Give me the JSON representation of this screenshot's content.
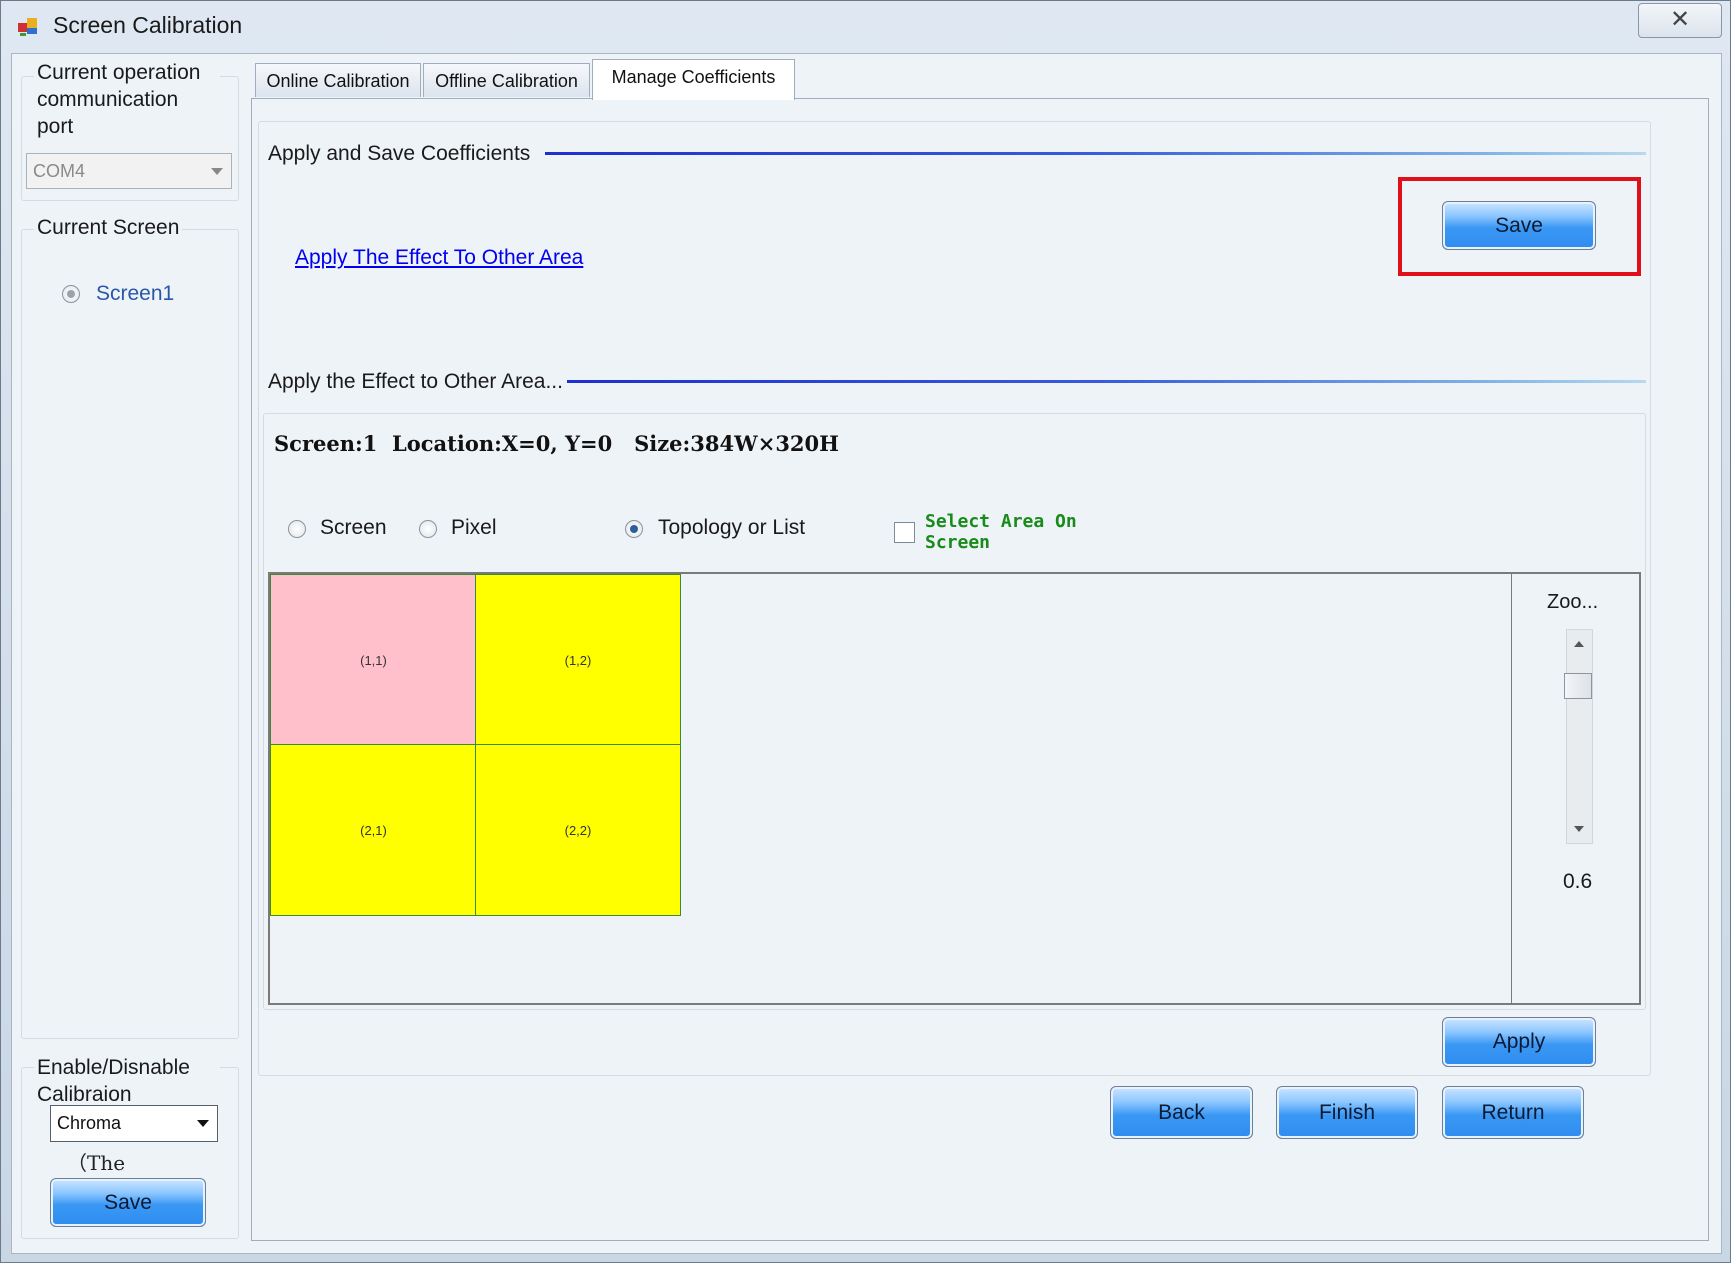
{
  "window": {
    "title": "Screen Calibration",
    "close_glyph": "✕"
  },
  "left": {
    "comm_group_label": "Current operation communication port",
    "com_port": "COM4",
    "screen_group_label": "Current Screen",
    "screen_item": "Screen1",
    "enable_group_label": "Enable/Disnable Calibraion",
    "enable_option": "Chroma",
    "note_text": "（The",
    "save_label": "Save"
  },
  "tabs": [
    {
      "label": "Online Calibration",
      "active": false
    },
    {
      "label": "Offline Calibration",
      "active": false
    },
    {
      "label": "Manage Coefficients",
      "active": true
    }
  ],
  "apply_save": {
    "title": "Apply and Save Coefficients",
    "link_text": "Apply The Effect To Other Area",
    "save_label": "Save"
  },
  "apply_other": {
    "title": "Apply the Effect to Other Area...",
    "info_text": "Screen:1  Location:X=0, Y=0   Size:384W×320H",
    "options": [
      "Screen",
      "Pixel",
      "Topology or List"
    ],
    "selected_option": "Topology or List",
    "select_area_label_line1": "Select Area On",
    "select_area_label_line2": "Screen",
    "cells": [
      {
        "label": "(1,1)",
        "color": "#ffc0cb"
      },
      {
        "label": "(1,2)",
        "color": "#ffff00"
      },
      {
        "label": "(2,1)",
        "color": "#ffff00"
      },
      {
        "label": "(2,2)",
        "color": "#ffff00"
      }
    ],
    "zoom_label": "Zoo...",
    "zoom_value": "0.6",
    "apply_label": "Apply"
  },
  "footer": {
    "back_label": "Back",
    "finish_label": "Finish",
    "return_label": "Return"
  },
  "colors": {
    "highlight": "#e0101a",
    "section_line": "#1e2fcf",
    "link": "#0000ee"
  }
}
